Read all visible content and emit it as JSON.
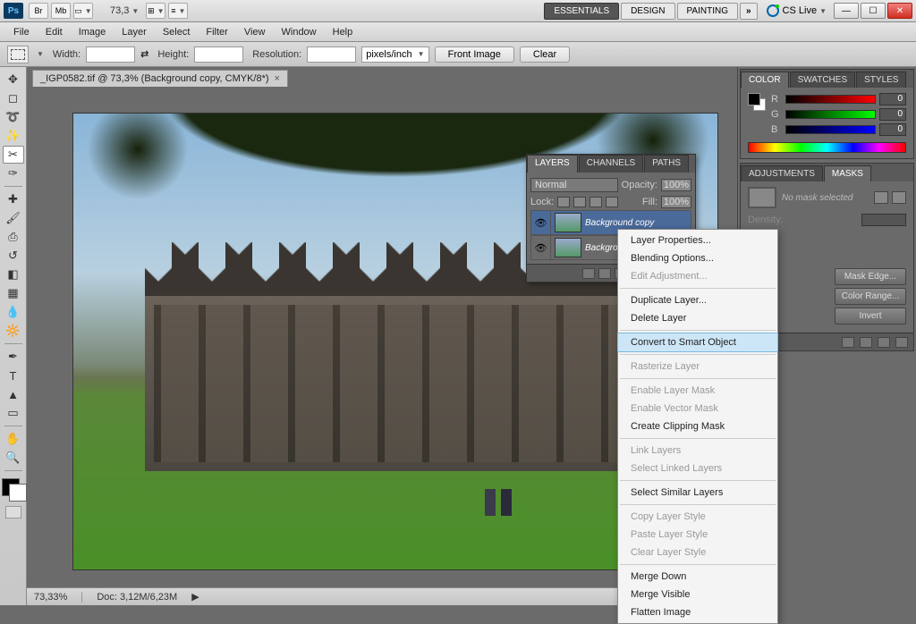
{
  "titlebar": {
    "ps": "Ps",
    "icons": [
      "Br",
      "Mb"
    ],
    "zoom": "73,3",
    "workspaces": {
      "essentials": "ESSENTIALS",
      "design": "DESIGN",
      "painting": "PAINTING",
      "more": "»"
    },
    "cslive": "CS Live"
  },
  "menu": [
    "File",
    "Edit",
    "Image",
    "Layer",
    "Select",
    "Filter",
    "View",
    "Window",
    "Help"
  ],
  "options": {
    "width_lbl": "Width:",
    "height_lbl": "Height:",
    "res_lbl": "Resolution:",
    "units": "pixels/inch",
    "front": "Front Image",
    "clear": "Clear",
    "swap": "⇄"
  },
  "doc_tab": {
    "title": "_IGP0582.tif @ 73,3% (Background copy, CMYK/8*)",
    "close": "×"
  },
  "status": {
    "zoom": "73,33%",
    "doc": "Doc: 3,12M/6,23M"
  },
  "color_panel": {
    "tabs": [
      "COLOR",
      "SWATCHES",
      "STYLES"
    ],
    "channels": [
      {
        "l": "R",
        "v": "0"
      },
      {
        "l": "G",
        "v": "0"
      },
      {
        "l": "B",
        "v": "0"
      }
    ]
  },
  "adj_panel": {
    "tabs": [
      "ADJUSTMENTS",
      "MASKS"
    ],
    "no_mask": "No mask selected",
    "density": "Density:",
    "btns": [
      "Mask Edge...",
      "Color Range...",
      "Invert"
    ]
  },
  "layers": {
    "tabs": [
      "LAYERS",
      "CHANNELS",
      "PATHS"
    ],
    "blend": "Normal",
    "opacity_lbl": "Opacity:",
    "opacity": "100%",
    "lock_lbl": "Lock:",
    "fill_lbl": "Fill:",
    "fill": "100%",
    "items": [
      {
        "name": "Background copy",
        "sel": true
      },
      {
        "name": "Background",
        "sel": false
      }
    ]
  },
  "ctx": [
    {
      "t": "Layer Properties...",
      "d": false
    },
    {
      "t": "Blending Options...",
      "d": false
    },
    {
      "t": "Edit Adjustment...",
      "d": true
    },
    {
      "sep": true
    },
    {
      "t": "Duplicate Layer...",
      "d": false
    },
    {
      "t": "Delete Layer",
      "d": false
    },
    {
      "sep": true
    },
    {
      "t": "Convert to Smart Object",
      "d": false,
      "h": true
    },
    {
      "sep": true
    },
    {
      "t": "Rasterize Layer",
      "d": true
    },
    {
      "sep": true
    },
    {
      "t": "Enable Layer Mask",
      "d": true
    },
    {
      "t": "Enable Vector Mask",
      "d": true
    },
    {
      "t": "Create Clipping Mask",
      "d": false
    },
    {
      "sep": true
    },
    {
      "t": "Link Layers",
      "d": true
    },
    {
      "t": "Select Linked Layers",
      "d": true
    },
    {
      "sep": true
    },
    {
      "t": "Select Similar Layers",
      "d": false
    },
    {
      "sep": true
    },
    {
      "t": "Copy Layer Style",
      "d": true
    },
    {
      "t": "Paste Layer Style",
      "d": true
    },
    {
      "t": "Clear Layer Style",
      "d": true
    },
    {
      "sep": true
    },
    {
      "t": "Merge Down",
      "d": false
    },
    {
      "t": "Merge Visible",
      "d": false
    },
    {
      "t": "Flatten Image",
      "d": false
    }
  ]
}
